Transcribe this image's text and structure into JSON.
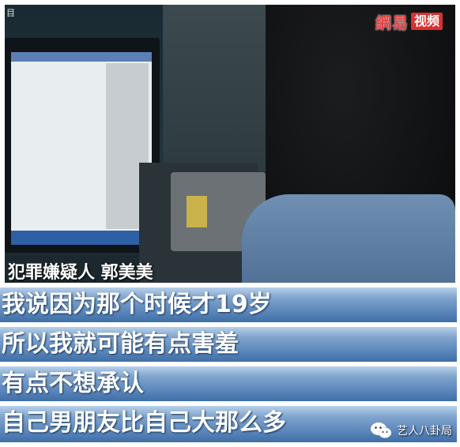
{
  "video": {
    "corner_mark": "目",
    "logo_net": "網易",
    "logo_video": "视频",
    "caption_name": "犯罪嫌疑人 郭美美"
  },
  "subtitles": [
    "我说因为那个时候才19岁",
    "所以我就可能有点害羞",
    "有点不想承认",
    "自己男朋友比自己大那么多"
  ],
  "watermark": {
    "icon": "wechat-icon",
    "text": "艺人八卦局"
  }
}
